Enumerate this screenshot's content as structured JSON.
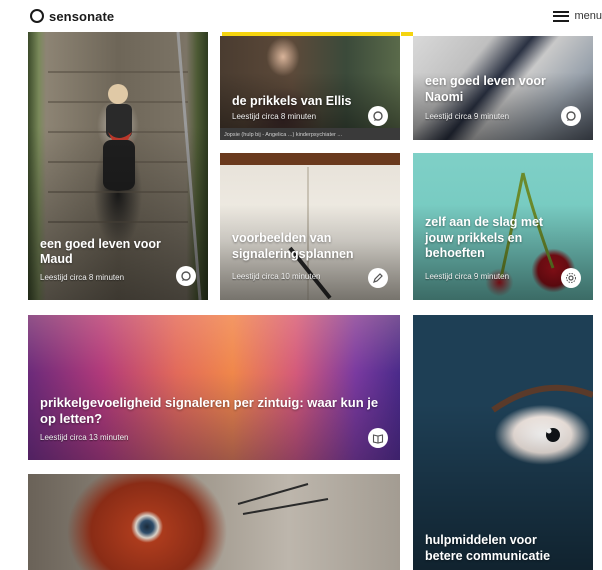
{
  "header": {
    "brand": "sensonate",
    "menu_label": "menu"
  },
  "cards": [
    {
      "title": "een goed leven voor Maud",
      "read_time": "Leestijd circa 8 minuten",
      "icon": "chat-icon"
    },
    {
      "title": "de prikkels van Ellis",
      "read_time": "Leestijd circa 8 minuten",
      "icon": "chat-icon",
      "caption": "Jopsie (hulp bij - Angelica ...) kinderpsychiater ..."
    },
    {
      "title": "een goed leven voor Naomi",
      "read_time": "Leestijd circa 9 minuten",
      "icon": "chat-icon"
    },
    {
      "title": "voorbeelden van signaleringsplannen",
      "read_time": "Leestijd circa 10 minuten",
      "icon": "pencil-icon"
    },
    {
      "title": "zelf aan de slag met jouw prikkels en behoeften",
      "read_time": "Leestijd circa 9 minuten",
      "icon": "gear-icon"
    },
    {
      "title": "prikkelgevoeligheid signaleren per zintuig: waar kun je op letten?",
      "read_time": "Leestijd circa 13 minuten",
      "icon": "book-icon"
    },
    {
      "title": "",
      "read_time": "",
      "icon": ""
    },
    {
      "title": "hulpmiddelen voor betere communicatie",
      "read_time": "",
      "icon": ""
    }
  ],
  "colors": {
    "accent_yellow": "#f5d40f",
    "text_white": "#ffffff"
  }
}
